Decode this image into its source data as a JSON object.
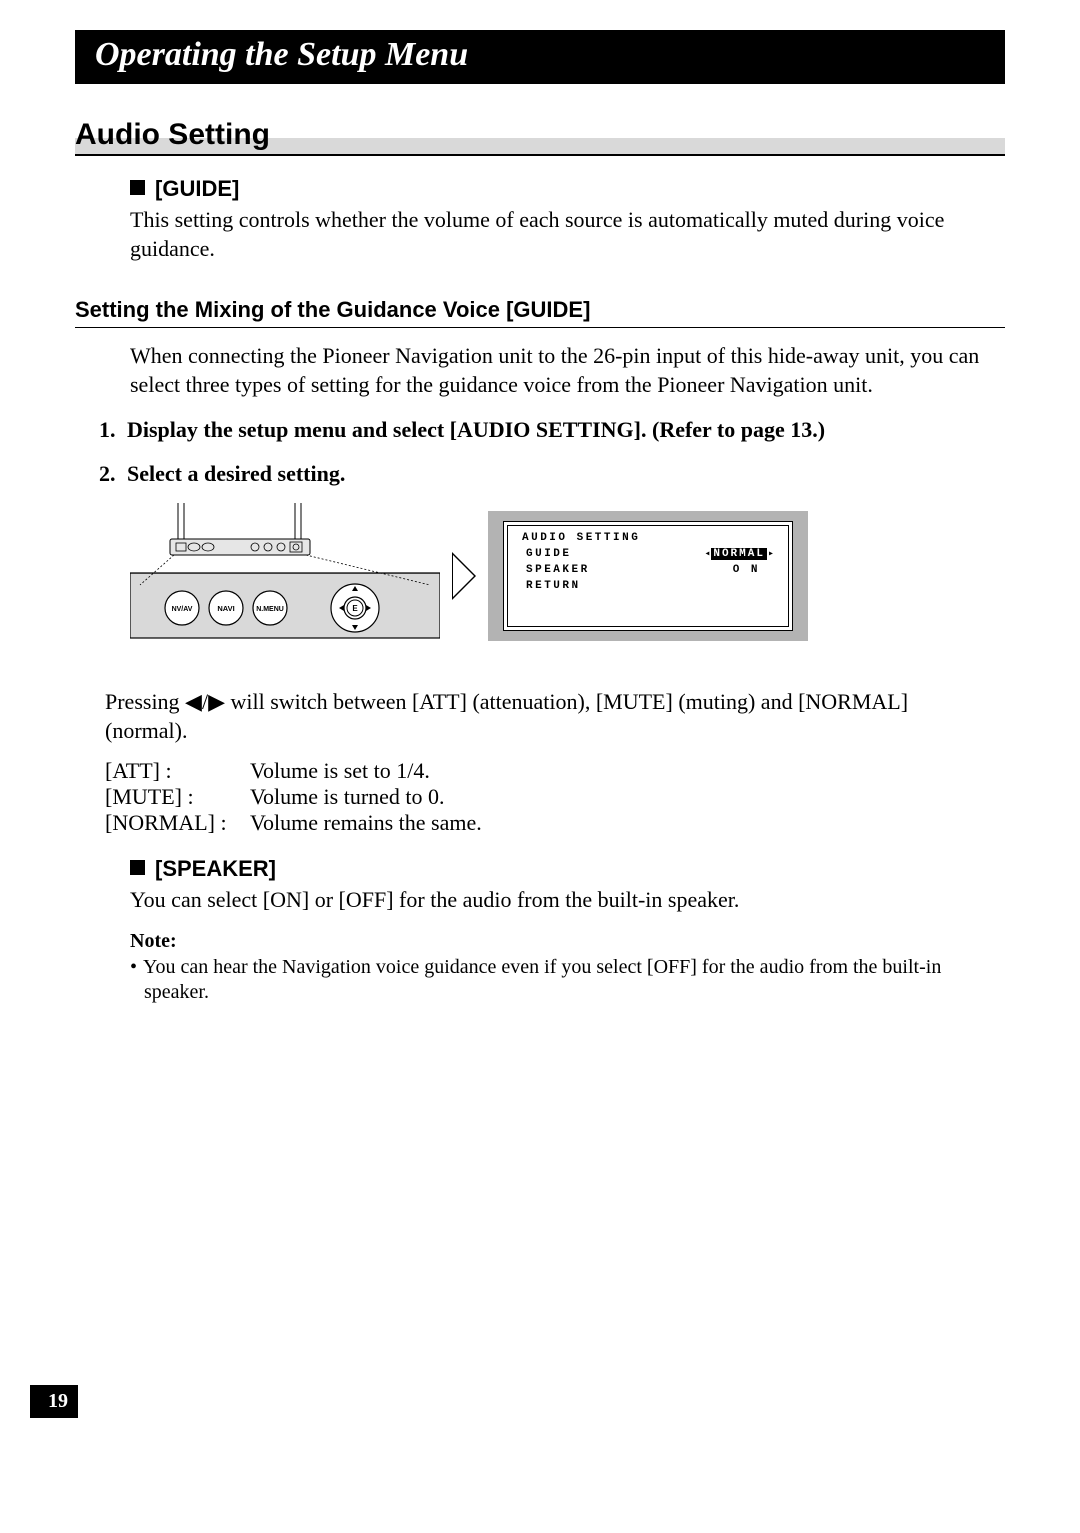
{
  "title_bar": "Operating the Setup Menu",
  "section": "Audio Setting",
  "guide": {
    "heading": "[GUIDE]",
    "body": "This setting controls whether the volume of each source is automatically muted during voice guidance."
  },
  "mixing": {
    "heading": "Setting the Mixing of the Guidance Voice [GUIDE]",
    "intro": "When connecting the Pioneer Navigation unit to the 26-pin input of this hide-away unit, you can select three types of setting for the guidance voice from the Pioneer Navigation unit.",
    "steps": [
      "Display the setup menu and select [AUDIO SETTING]. (Refer to page 13.)",
      "Select a desired setting."
    ],
    "pressing": "Pressing ◀/▶ will switch between [ATT] (attenuation), [MUTE] (muting) and [NORMAL] (normal).",
    "defs": [
      {
        "label": "[ATT] :",
        "value": "Volume is set to 1/4."
      },
      {
        "label": "[MUTE] :",
        "value": "Volume is turned to 0."
      },
      {
        "label": "[NORMAL] :",
        "value": "Volume remains the same."
      }
    ]
  },
  "speaker": {
    "heading": "[SPEAKER]",
    "body": "You can select [ON] or [OFF] for the audio from the built-in speaker.",
    "note_label": "Note:",
    "note_body": "You can hear the Navigation voice guidance even if you select [OFF] for the audio from the built-in speaker."
  },
  "device_diagram": {
    "buttons": [
      "NV/AV",
      "NAVI",
      "N.MENU",
      "E"
    ]
  },
  "screen": {
    "title": "AUDIO SETTING",
    "rows": [
      {
        "left": "GUIDE",
        "right": "NORMAL",
        "highlight": true
      },
      {
        "left": "SPEAKER",
        "right": "O N",
        "highlight": false
      },
      {
        "left": " RETURN",
        "right": "",
        "highlight": false
      }
    ]
  },
  "page_number": "19"
}
